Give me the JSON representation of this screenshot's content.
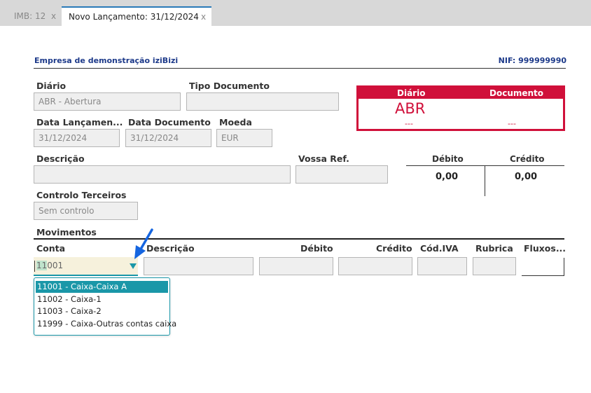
{
  "tabs": [
    {
      "label": "IMB: 12",
      "close": "x"
    },
    {
      "label": "Novo Lançamento: 31/12/2024",
      "close": "x"
    }
  ],
  "header": {
    "company": "Empresa de demonstração iziBizi",
    "nif": "NIF: 999999990"
  },
  "form": {
    "diario": {
      "label": "Diário",
      "value": "ABR - Abertura"
    },
    "tipo_documento": {
      "label": "Tipo Documento",
      "value": ""
    },
    "data_lancamento": {
      "label": "Data Lançamen...",
      "value": "31/12/2024"
    },
    "data_documento": {
      "label": "Data Documento",
      "value": "31/12/2024"
    },
    "moeda": {
      "label": "Moeda",
      "value": "EUR"
    },
    "descricao": {
      "label": "Descrição",
      "value": ""
    },
    "vossa_ref": {
      "label": "Vossa Ref.",
      "value": ""
    },
    "controlo_terceiros": {
      "label": "Controlo Terceiros",
      "value": "Sem controlo"
    }
  },
  "summary_box": {
    "diario_label": "Diário",
    "documento_label": "Documento",
    "diario_value": "ABR",
    "diario_dash": "---",
    "documento_dash": "---",
    "color": "#d0103a"
  },
  "totals": {
    "debito_label": "Débito",
    "credito_label": "Crédito",
    "debito_value": "0,00",
    "credito_value": "0,00"
  },
  "movimentos": {
    "title": "Movimentos",
    "columns": [
      "Conta",
      "Descrição",
      "Débito",
      "Crédito",
      "Cód.IVA",
      "Rubrica",
      "Fluxos..."
    ],
    "conta_input": {
      "prefix": "",
      "selected": "11",
      "rest": "001"
    },
    "options": [
      "11001 - Caixa-Caixa A",
      "11002 - Caixa-1",
      "11003 - Caixa-2",
      "11999 - Caixa-Outras contas caixa"
    ],
    "highlight_color": "#1a97a8"
  }
}
